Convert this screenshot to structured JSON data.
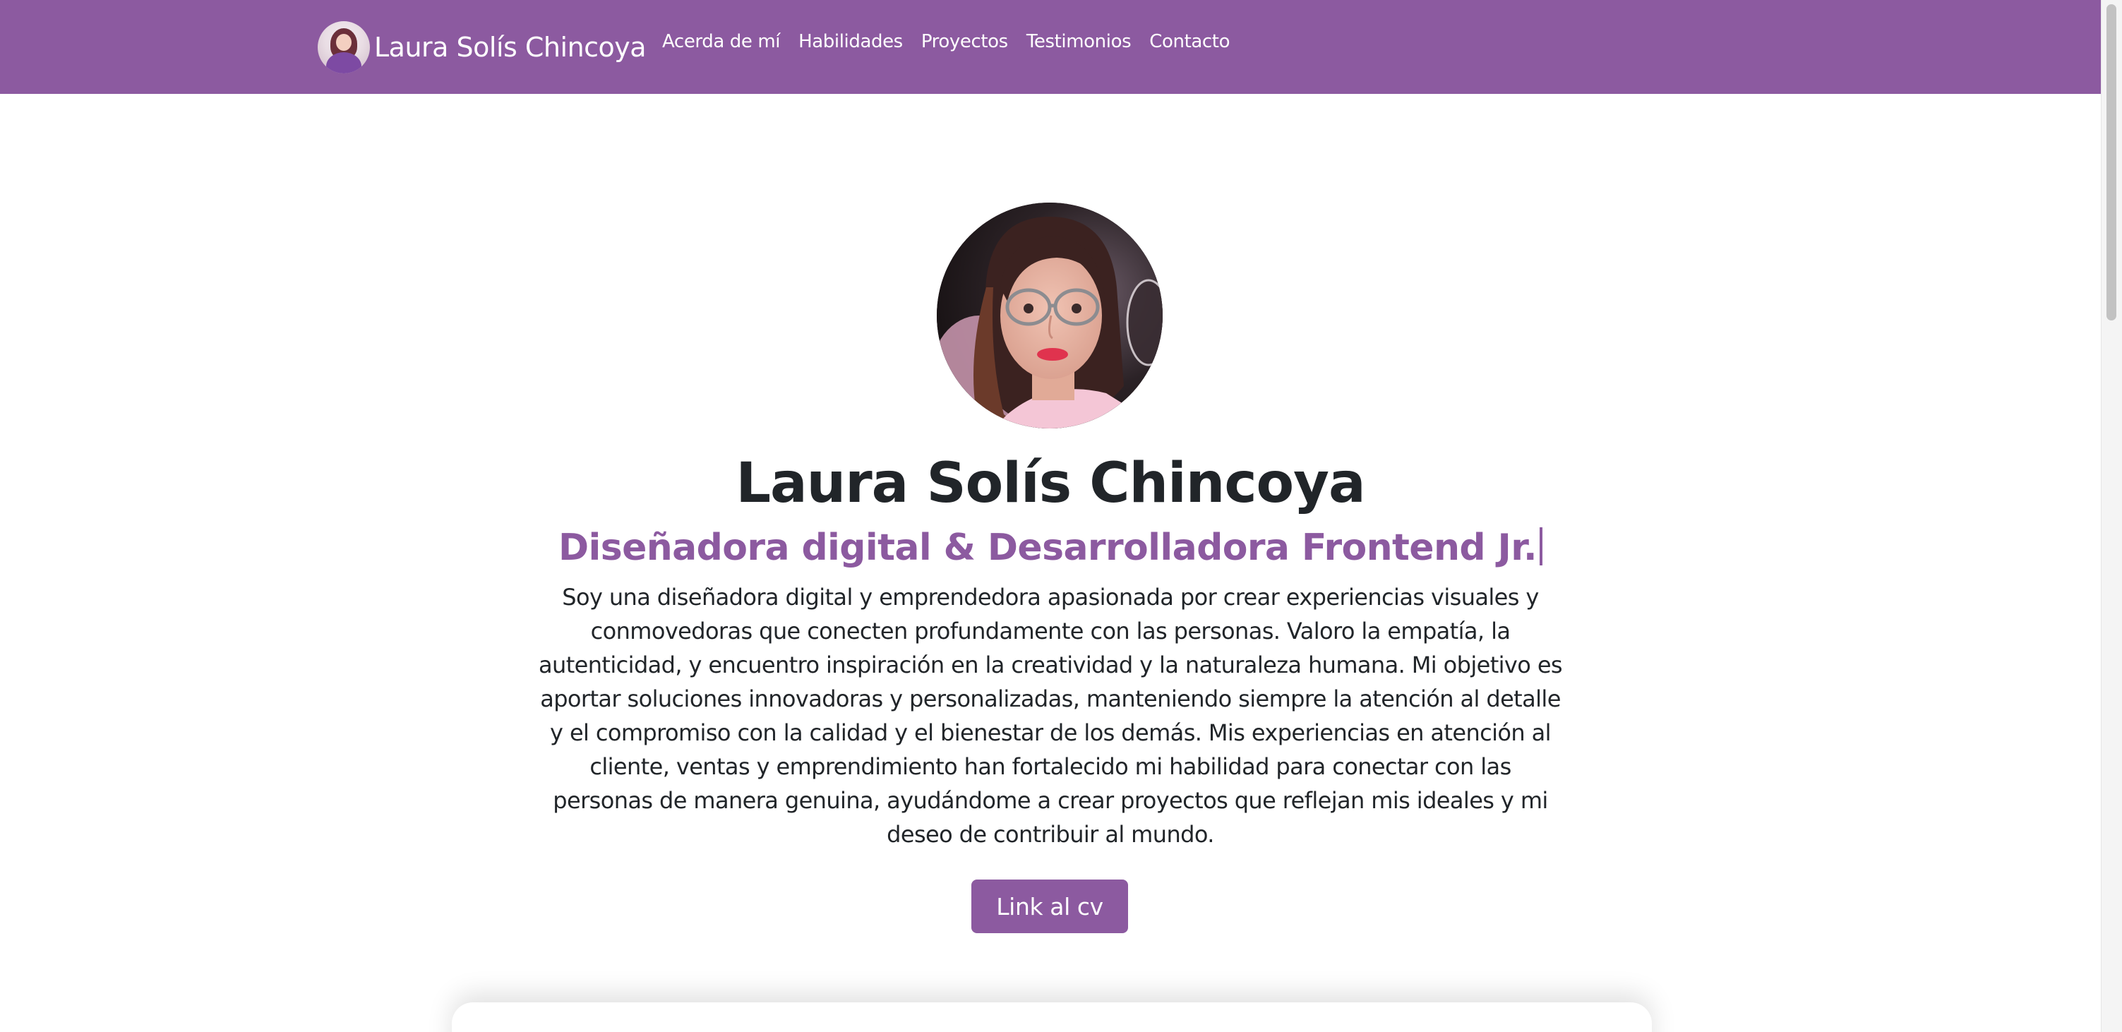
{
  "navbar": {
    "brand_name": "Laura Solís Chincoya",
    "links": [
      {
        "label": "Acerda de mí"
      },
      {
        "label": "Habilidades"
      },
      {
        "label": "Proyectos"
      },
      {
        "label": "Testimonios"
      },
      {
        "label": "Contacto"
      }
    ],
    "background_color": "#8c5aa0"
  },
  "hero": {
    "name": "Laura Solís Chincoya",
    "subtitle": "Diseñadora digital & Desarrolladora Frontend Jr.",
    "description": "Soy una diseñadora digital y emprendedora apasionada por crear experiencias visuales y conmovedoras que conecten profundamente con las personas. Valoro la empatía, la autenticidad, y encuentro inspiración en la creatividad y la naturaleza humana. Mi objetivo es aportar soluciones innovadoras y personalizadas, manteniendo siempre la atención al detalle y el compromiso con la calidad y el bienestar de los demás. Mis experiencias en atención al cliente, ventas y emprendimiento han fortalecido mi habilidad para conectar con las personas de manera genuina, ayudándome a crear proyectos que reflejan mis ideales y mi deseo de contribuir al mundo.",
    "cv_button_label": "Link al cv",
    "accent_color": "#8c5aa0"
  }
}
